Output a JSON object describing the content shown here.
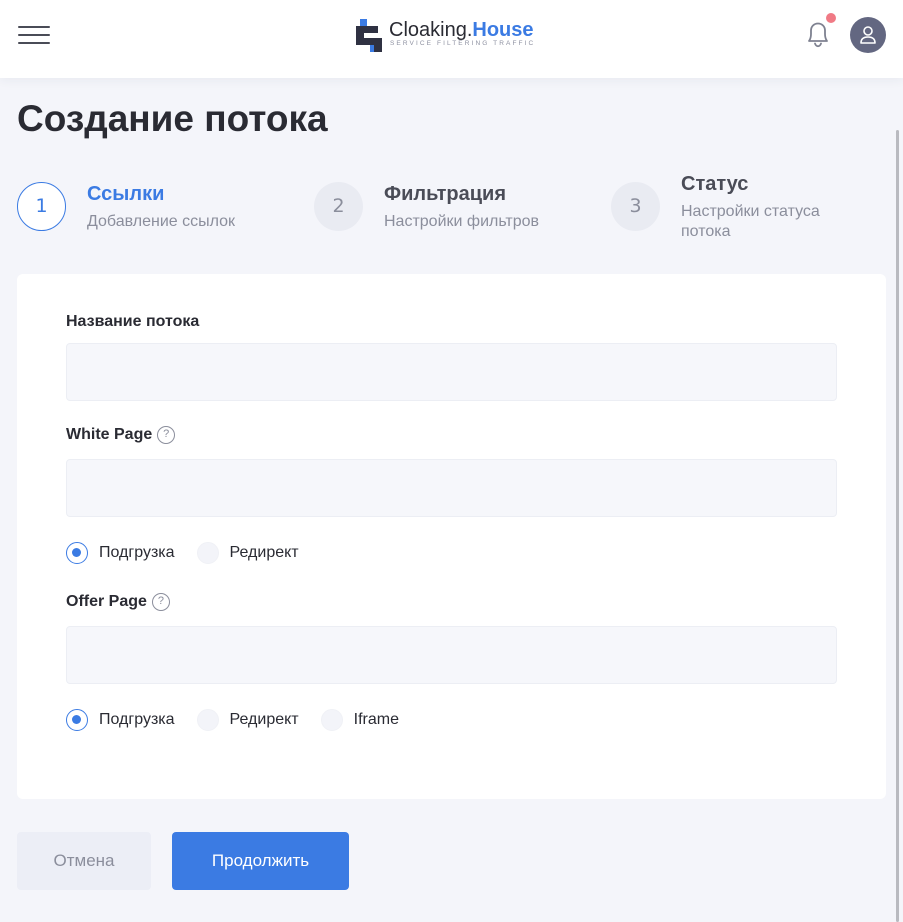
{
  "header": {
    "logo_main": "Cloaking.",
    "logo_accent": "House",
    "logo_tagline": "SERVICE FILTERING TRAFFIC",
    "has_notification": true
  },
  "page": {
    "title": "Создание потока"
  },
  "steps": [
    {
      "number": "1",
      "title": "Ссылки",
      "subtitle": "Добавление ссылок",
      "active": true
    },
    {
      "number": "2",
      "title": "Фильтрация",
      "subtitle": "Настройки фильтров",
      "active": false
    },
    {
      "number": "3",
      "title": "Статус",
      "subtitle": "Настройки статуса потока",
      "active": false
    }
  ],
  "form": {
    "stream_name": {
      "label": "Название потока",
      "value": "",
      "placeholder": ""
    },
    "white_page": {
      "label": "White Page",
      "help": "?",
      "value": "",
      "placeholder": "",
      "options": [
        "Подгрузка",
        "Редирект"
      ],
      "selected": "Подгрузка"
    },
    "offer_page": {
      "label": "Offer Page",
      "help": "?",
      "value": "",
      "placeholder": "",
      "options": [
        "Подгрузка",
        "Редирект",
        "Iframe"
      ],
      "selected": "Подгрузка"
    }
  },
  "actions": {
    "cancel_label": "Отмена",
    "continue_label": "Продолжить"
  },
  "colors": {
    "accent": "#3b7be3",
    "background": "#f4f5fa",
    "notification": "#f07a85"
  }
}
